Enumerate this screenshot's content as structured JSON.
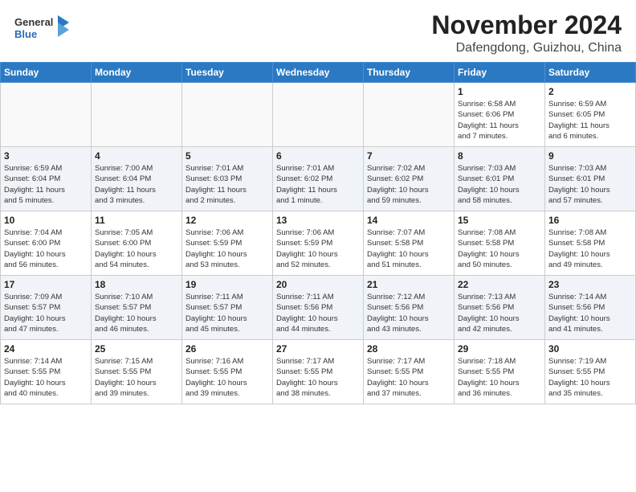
{
  "header": {
    "logo_general": "General",
    "logo_blue": "Blue",
    "month": "November 2024",
    "location": "Dafengdong, Guizhou, China"
  },
  "weekdays": [
    "Sunday",
    "Monday",
    "Tuesday",
    "Wednesday",
    "Thursday",
    "Friday",
    "Saturday"
  ],
  "weeks": [
    [
      {
        "day": "",
        "info": ""
      },
      {
        "day": "",
        "info": ""
      },
      {
        "day": "",
        "info": ""
      },
      {
        "day": "",
        "info": ""
      },
      {
        "day": "",
        "info": ""
      },
      {
        "day": "1",
        "info": "Sunrise: 6:58 AM\nSunset: 6:06 PM\nDaylight: 11 hours\nand 7 minutes."
      },
      {
        "day": "2",
        "info": "Sunrise: 6:59 AM\nSunset: 6:05 PM\nDaylight: 11 hours\nand 6 minutes."
      }
    ],
    [
      {
        "day": "3",
        "info": "Sunrise: 6:59 AM\nSunset: 6:04 PM\nDaylight: 11 hours\nand 5 minutes."
      },
      {
        "day": "4",
        "info": "Sunrise: 7:00 AM\nSunset: 6:04 PM\nDaylight: 11 hours\nand 3 minutes."
      },
      {
        "day": "5",
        "info": "Sunrise: 7:01 AM\nSunset: 6:03 PM\nDaylight: 11 hours\nand 2 minutes."
      },
      {
        "day": "6",
        "info": "Sunrise: 7:01 AM\nSunset: 6:02 PM\nDaylight: 11 hours\nand 1 minute."
      },
      {
        "day": "7",
        "info": "Sunrise: 7:02 AM\nSunset: 6:02 PM\nDaylight: 10 hours\nand 59 minutes."
      },
      {
        "day": "8",
        "info": "Sunrise: 7:03 AM\nSunset: 6:01 PM\nDaylight: 10 hours\nand 58 minutes."
      },
      {
        "day": "9",
        "info": "Sunrise: 7:03 AM\nSunset: 6:01 PM\nDaylight: 10 hours\nand 57 minutes."
      }
    ],
    [
      {
        "day": "10",
        "info": "Sunrise: 7:04 AM\nSunset: 6:00 PM\nDaylight: 10 hours\nand 56 minutes."
      },
      {
        "day": "11",
        "info": "Sunrise: 7:05 AM\nSunset: 6:00 PM\nDaylight: 10 hours\nand 54 minutes."
      },
      {
        "day": "12",
        "info": "Sunrise: 7:06 AM\nSunset: 5:59 PM\nDaylight: 10 hours\nand 53 minutes."
      },
      {
        "day": "13",
        "info": "Sunrise: 7:06 AM\nSunset: 5:59 PM\nDaylight: 10 hours\nand 52 minutes."
      },
      {
        "day": "14",
        "info": "Sunrise: 7:07 AM\nSunset: 5:58 PM\nDaylight: 10 hours\nand 51 minutes."
      },
      {
        "day": "15",
        "info": "Sunrise: 7:08 AM\nSunset: 5:58 PM\nDaylight: 10 hours\nand 50 minutes."
      },
      {
        "day": "16",
        "info": "Sunrise: 7:08 AM\nSunset: 5:58 PM\nDaylight: 10 hours\nand 49 minutes."
      }
    ],
    [
      {
        "day": "17",
        "info": "Sunrise: 7:09 AM\nSunset: 5:57 PM\nDaylight: 10 hours\nand 47 minutes."
      },
      {
        "day": "18",
        "info": "Sunrise: 7:10 AM\nSunset: 5:57 PM\nDaylight: 10 hours\nand 46 minutes."
      },
      {
        "day": "19",
        "info": "Sunrise: 7:11 AM\nSunset: 5:57 PM\nDaylight: 10 hours\nand 45 minutes."
      },
      {
        "day": "20",
        "info": "Sunrise: 7:11 AM\nSunset: 5:56 PM\nDaylight: 10 hours\nand 44 minutes."
      },
      {
        "day": "21",
        "info": "Sunrise: 7:12 AM\nSunset: 5:56 PM\nDaylight: 10 hours\nand 43 minutes."
      },
      {
        "day": "22",
        "info": "Sunrise: 7:13 AM\nSunset: 5:56 PM\nDaylight: 10 hours\nand 42 minutes."
      },
      {
        "day": "23",
        "info": "Sunrise: 7:14 AM\nSunset: 5:56 PM\nDaylight: 10 hours\nand 41 minutes."
      }
    ],
    [
      {
        "day": "24",
        "info": "Sunrise: 7:14 AM\nSunset: 5:55 PM\nDaylight: 10 hours\nand 40 minutes."
      },
      {
        "day": "25",
        "info": "Sunrise: 7:15 AM\nSunset: 5:55 PM\nDaylight: 10 hours\nand 39 minutes."
      },
      {
        "day": "26",
        "info": "Sunrise: 7:16 AM\nSunset: 5:55 PM\nDaylight: 10 hours\nand 39 minutes."
      },
      {
        "day": "27",
        "info": "Sunrise: 7:17 AM\nSunset: 5:55 PM\nDaylight: 10 hours\nand 38 minutes."
      },
      {
        "day": "28",
        "info": "Sunrise: 7:17 AM\nSunset: 5:55 PM\nDaylight: 10 hours\nand 37 minutes."
      },
      {
        "day": "29",
        "info": "Sunrise: 7:18 AM\nSunset: 5:55 PM\nDaylight: 10 hours\nand 36 minutes."
      },
      {
        "day": "30",
        "info": "Sunrise: 7:19 AM\nSunset: 5:55 PM\nDaylight: 10 hours\nand 35 minutes."
      }
    ]
  ]
}
